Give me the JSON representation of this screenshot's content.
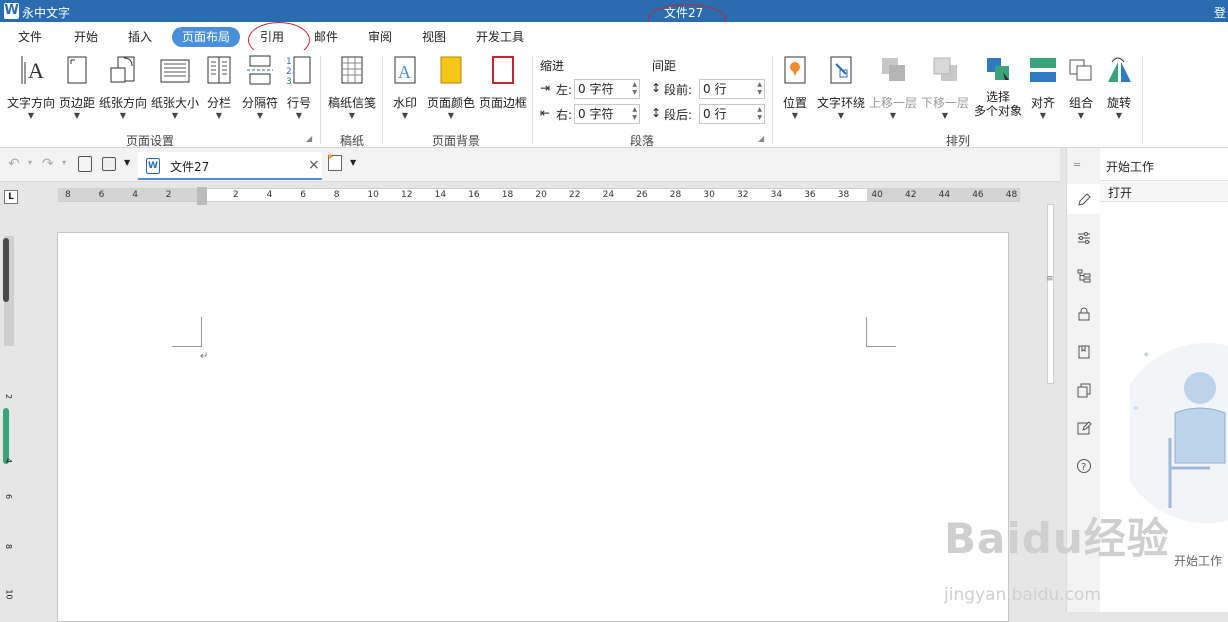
{
  "titlebar": {
    "app_name": "永中文字",
    "doc_title": "文件27",
    "login": "登",
    "logo": "W"
  },
  "menu": [
    "文件",
    "开始",
    "插入",
    "页面布局",
    "引用",
    "邮件",
    "审阅",
    "视图",
    "开发工具"
  ],
  "active_menu": "页面布局",
  "ribbon": {
    "page_setup": {
      "group_label": "页面设置",
      "buttons": [
        "文字方向",
        "页边距",
        "纸张方向",
        "纸张大小",
        "分栏",
        "分隔符",
        "行号"
      ]
    },
    "manuscript": {
      "group_label": "稿纸",
      "buttons": [
        "稿纸信笺"
      ]
    },
    "background": {
      "group_label": "页面背景",
      "buttons": [
        "水印",
        "页面颜色",
        "页面边框"
      ]
    },
    "paragraph": {
      "group_label": "段落",
      "indent_title": "缩进",
      "spacing_title": "间距",
      "indent_left_label": "左:",
      "indent_left_value": "0 字符",
      "indent_right_label": "右:",
      "indent_right_value": "0 字符",
      "spacing_before_label": "段前:",
      "spacing_before_value": "0 行",
      "spacing_after_label": "段后:",
      "spacing_after_value": "0 行"
    },
    "arrange": {
      "group_label": "排列",
      "buttons": [
        "位置",
        "文字环绕",
        "上移一层",
        "下移一层",
        "选择\n多个对象",
        "对齐",
        "组合",
        "旋转"
      ]
    }
  },
  "doc_tab": {
    "label": "文件27",
    "close": "×"
  },
  "ruler_numbers": [
    "8",
    "6",
    "4",
    "2",
    "",
    "2",
    "4",
    "6",
    "8",
    "10",
    "12",
    "14",
    "16",
    "18",
    "20",
    "22",
    "24",
    "26",
    "28",
    "30",
    "32",
    "34",
    "36",
    "38",
    "40",
    "42",
    "44",
    "46",
    "48"
  ],
  "ruler_corner": "L",
  "vertical_ruler_numbers": [
    "2",
    "4",
    "6",
    "8",
    "10"
  ],
  "side_panel": {
    "title": "开始工作",
    "open_label": "打开",
    "footer": "开始工作"
  },
  "watermark": {
    "brand": "Baidu经验",
    "url": "jingyan.baidu.com"
  },
  "colors": {
    "titlebar": "#2b6cb0",
    "accent": "#4a8fdb",
    "annotation_circle": "#c0282d"
  }
}
